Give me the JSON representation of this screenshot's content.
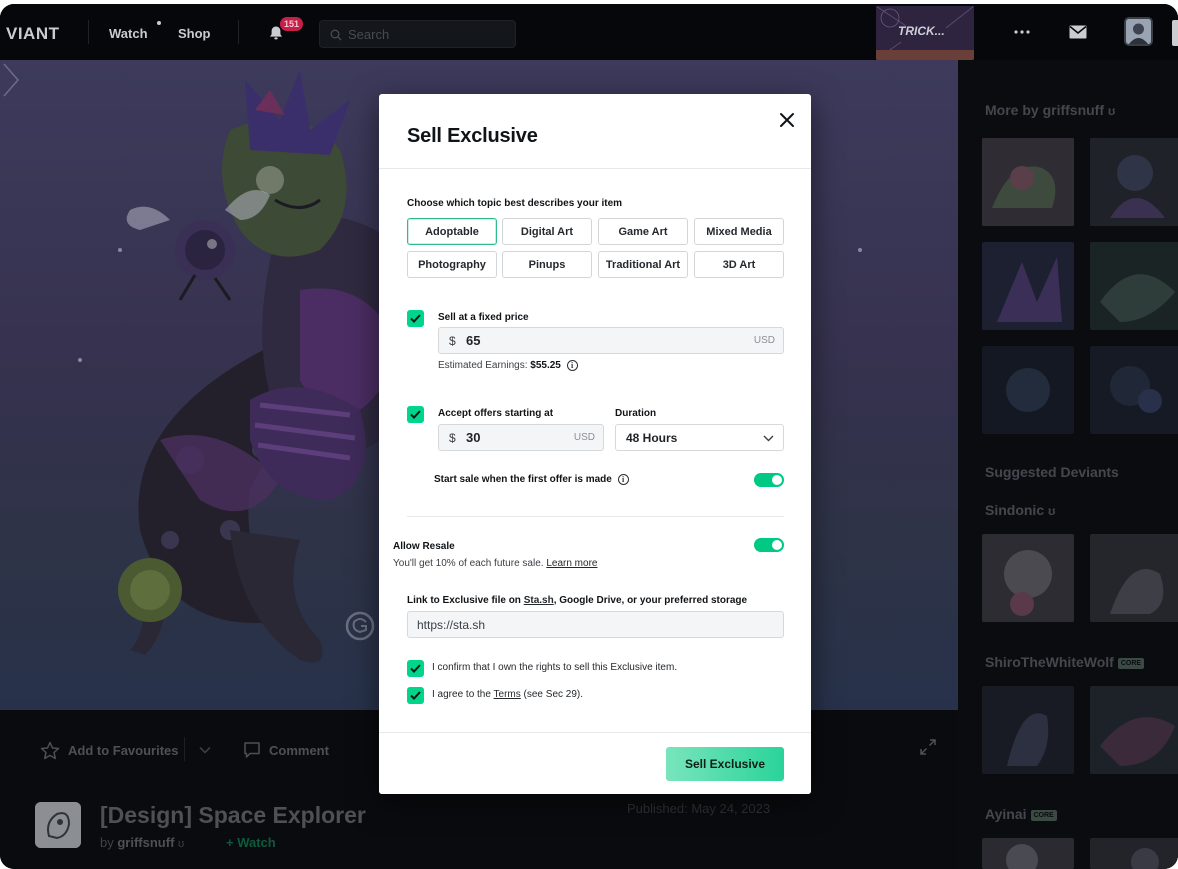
{
  "nav": {
    "logo": "VIANT",
    "watch": "Watch",
    "shop": "Shop",
    "notification_count": "151",
    "search_placeholder": "Search",
    "promo_text": "TRICK..."
  },
  "artwork": {
    "add_to_favourites": "Add to Favourites",
    "comment": "Comment",
    "title": "[Design] Space Explorer",
    "by": "by",
    "author": "griffsnuff",
    "watch": "+ Watch",
    "published": "Published: May 24, 2023"
  },
  "sidebar": {
    "more_by": "More by griffsnuff",
    "suggested": "Suggested Deviants",
    "deviants": [
      {
        "name": "Sindonic",
        "badge": ""
      },
      {
        "name": "ShiroTheWhiteWolf",
        "badge": "CORE"
      },
      {
        "name": "Ayinai",
        "badge": "CORE"
      }
    ]
  },
  "modal": {
    "title": "Sell Exclusive",
    "topic_prompt": "Choose which topic best describes your item",
    "topics": [
      "Adoptable",
      "Digital Art",
      "Game Art",
      "Mixed Media",
      "Photography",
      "Pinups",
      "Traditional Art",
      "3D Art"
    ],
    "selected_topic": "Adoptable",
    "fixed_price": {
      "label": "Sell at a fixed price",
      "checked": true,
      "currency_symbol": "$",
      "value": "65",
      "unit": "USD",
      "earnings_label": "Estimated Earnings:",
      "earnings_value": "$55.25"
    },
    "offers": {
      "label": "Accept offers starting at",
      "checked": true,
      "currency_symbol": "$",
      "value": "30",
      "unit": "USD",
      "duration_label": "Duration",
      "duration_value": "48 Hours"
    },
    "start_sale": {
      "label": "Start sale when the first offer is made",
      "enabled": true
    },
    "resale": {
      "label": "Allow Resale",
      "description": "You'll get 10% of each future sale.",
      "learn_more": "Learn more",
      "enabled": true
    },
    "file_link": {
      "label_prefix": "Link to Exclusive file on ",
      "label_link": "Sta.sh",
      "label_suffix": ", Google Drive, or your preferred storage",
      "value": "https://sta.sh"
    },
    "confirm_rights": "I confirm that I own the rights to sell this Exclusive item.",
    "agree_prefix": "I agree to the ",
    "agree_terms": "Terms",
    "agree_suffix": " (see Sec 29).",
    "submit": "Sell Exclusive"
  },
  "colors": {
    "accent": "#00d58b",
    "page_bg": "#06070a",
    "toggle_on": "#00c983"
  }
}
